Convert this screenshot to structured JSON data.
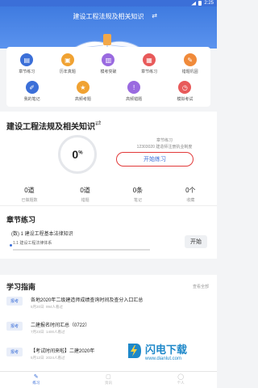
{
  "status_bar": {
    "time": "2:25"
  },
  "header": {
    "title": "建设工程法规及相关知识",
    "switch_icon": "⇄"
  },
  "features": [
    {
      "label": "章节练习",
      "color": "#3b6fd8",
      "glyph": "▤",
      "icon": "chapter-practice-icon"
    },
    {
      "label": "历年真题",
      "color": "#f0a232",
      "glyph": "▣",
      "icon": "past-exam-icon"
    },
    {
      "label": "模考突破",
      "color": "#9a6ae0",
      "glyph": "▥",
      "icon": "mock-breakthrough-icon"
    },
    {
      "label": "章节练习",
      "color": "#e85a5a",
      "glyph": "▦",
      "icon": "chapter-practice-2-icon"
    },
    {
      "label": "错题巩固",
      "color": "#f08a3a",
      "glyph": "✎",
      "icon": "wrong-questions-icon"
    },
    {
      "label": "我的笔记",
      "color": "#3b6fd8",
      "glyph": "✐",
      "icon": "notes-icon"
    },
    {
      "label": "高频考题",
      "color": "#f0a232",
      "glyph": "★",
      "icon": "frequent-questions-icon"
    },
    {
      "label": "高频错题",
      "color": "#9a6ae0",
      "glyph": "!",
      "icon": "frequent-errors-icon"
    },
    {
      "label": "模拟考试",
      "color": "#e85a5a",
      "glyph": "◷",
      "icon": "mock-exam-icon"
    }
  ],
  "subject": {
    "name": "建设工程法规及相关知识",
    "switch_icon": "⇄",
    "progress": "0",
    "progress_unit": "%",
    "meta_line1": "章节练习",
    "meta_line2": "12303020",
    "meta_line3": "建造师注册执业制度",
    "start_label": "开始练习"
  },
  "stats": [
    {
      "value": "0道",
      "label": "已做题数"
    },
    {
      "value": "0道",
      "label": "错题"
    },
    {
      "value": "0条",
      "label": "笔记"
    },
    {
      "value": "0个",
      "label": "收藏"
    }
  ],
  "chapter": {
    "title": "章节练习",
    "item1": "(数) 1 建设工程基本法律知识",
    "item2": "1.1 建设工程法律体系",
    "start_label": "开始"
  },
  "guide": {
    "title": "学习指南",
    "more": "查看全部",
    "items": [
      {
        "tag": "报考",
        "title": "各地2020年二级建造师成绩查询时间及查分入口汇总",
        "date": "5月20日",
        "views": "994人看过"
      },
      {
        "tag": "报考",
        "title": "二建报名时间汇总（0722）",
        "date": "7月23日",
        "views": "1400人看过"
      },
      {
        "tag": "报考",
        "title": "【考试时间来啦】二建2020年",
        "date": "5月12日",
        "views": "2024人看过"
      }
    ]
  },
  "watermark": {
    "brand": "闪电下载",
    "url": "www.dianlut.com"
  },
  "tabs": [
    {
      "label": "练习",
      "glyph": "✎",
      "icon": "practice-tab-icon",
      "active": true
    },
    {
      "label": "资讯",
      "glyph": "▢",
      "icon": "news-tab-icon",
      "active": false
    },
    {
      "label": "个人",
      "glyph": "◯",
      "icon": "profile-tab-icon",
      "active": false
    }
  ]
}
